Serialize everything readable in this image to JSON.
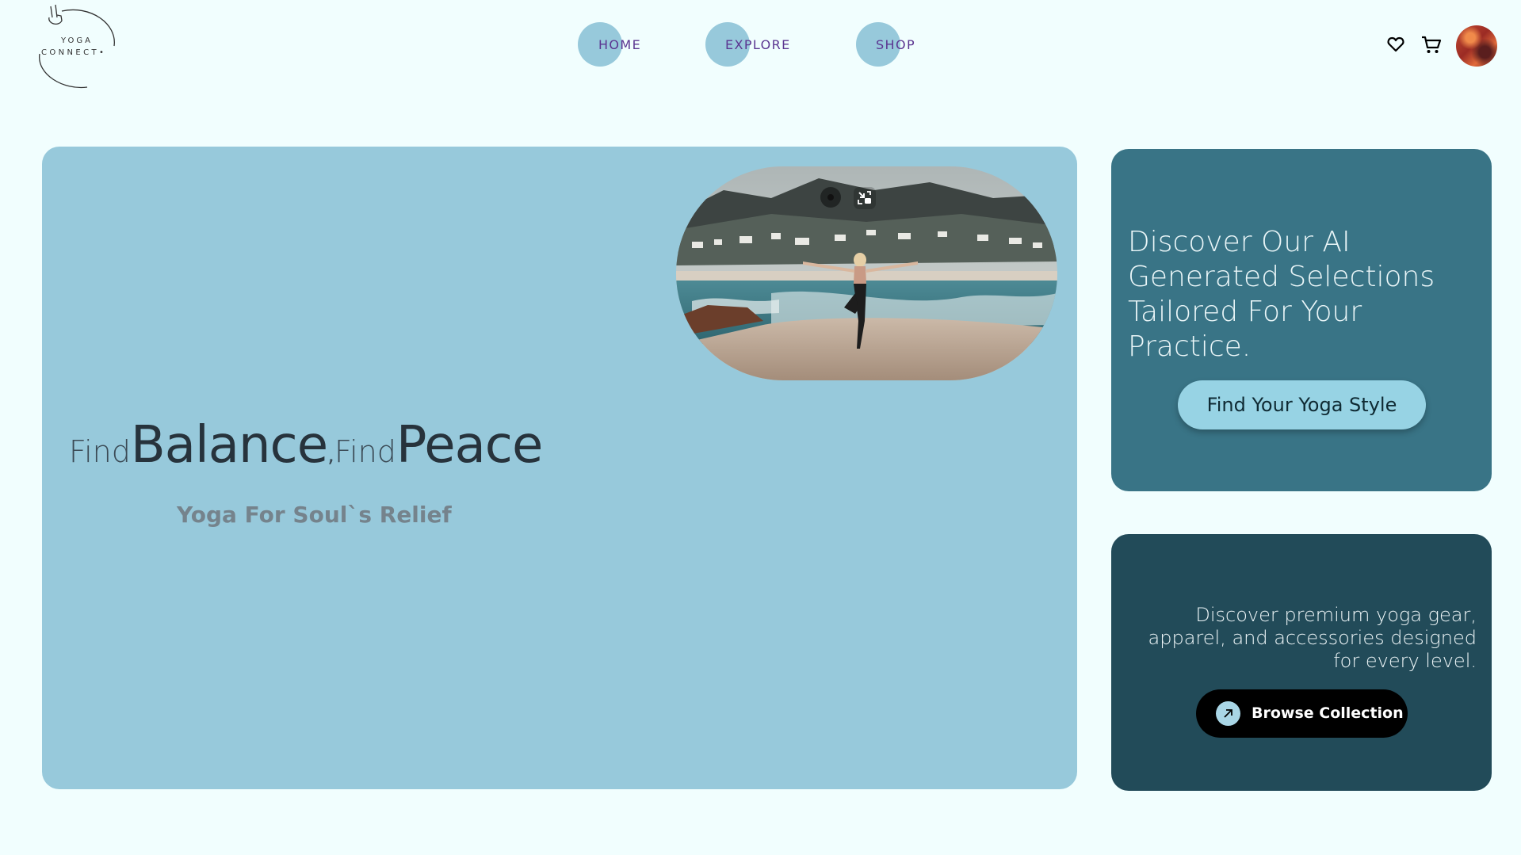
{
  "brand": {
    "logo_line1": "YOGA",
    "logo_line2": "CONNECT•",
    "logo_icon": "peace-hand-icon"
  },
  "nav": {
    "items": [
      {
        "label": "HOME"
      },
      {
        "label": "EXPLORE"
      },
      {
        "label": "SHOP"
      }
    ]
  },
  "header_icons": [
    "heart-icon",
    "cart-icon",
    "avatar"
  ],
  "hero": {
    "word1": "Find",
    "word2": "Balance",
    "comma": ",",
    "word3": "Find",
    "word4": "Peace",
    "tagline": "Yoga For Soul`s Relief",
    "media_controls": [
      "record-dot",
      "exit-fullscreen-icon"
    ]
  },
  "ai_card": {
    "text": "Discover Our AI Generated Selections Tailored For Your Practice.",
    "button": "Find Your Yoga Style"
  },
  "gear_card": {
    "text": "Discover premium yoga gear, apparel, and accessories designed for every level.",
    "button": "Browse Collection"
  },
  "colors": {
    "page_bg": "#f1fefe",
    "hero_bg": "#97c9db",
    "ai_card_bg": "#397486",
    "gear_card_bg": "#224b59",
    "nav_text": "#5b3591",
    "accent_button": "#97d3e4"
  }
}
